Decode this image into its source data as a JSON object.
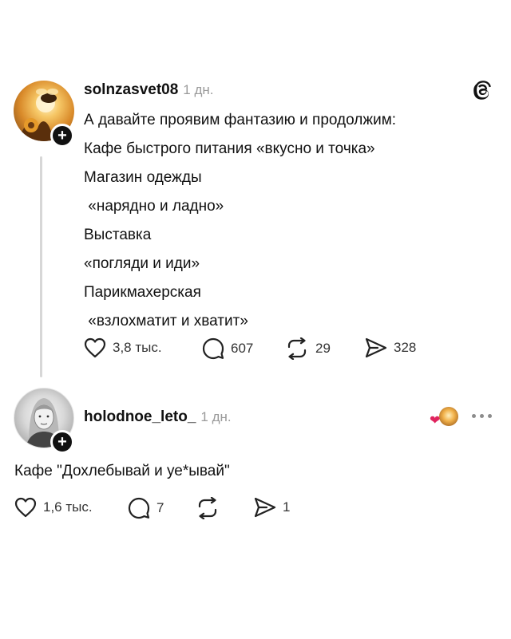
{
  "post": {
    "username": "solnzasvet08",
    "time": "1 дн.",
    "lines": [
      "А давайте проявим фантазию и продолжим:",
      "Кафе быстрого питания «вкусно и точка»",
      "Магазин одежды",
      " «нарядно и ладно»",
      "Выставка",
      "«погляди и иди»",
      "Парикмахерская",
      " «взлохматит и хватит»"
    ],
    "likes": "3,8 тыс.",
    "comments": "607",
    "reposts": "29",
    "shares": "328"
  },
  "reply": {
    "username": "holodnoe_leto_",
    "time": "1 дн.",
    "text": "Кафе \"Дохлебывай и уе*ывай\"",
    "likes": "1,6 тыс.",
    "comments": "7",
    "shares": "1"
  },
  "icons": {
    "threads_logo": "threads-logo-icon",
    "heart": "heart-icon",
    "comment": "comment-bubble-icon",
    "repost": "repost-icon",
    "share": "send-icon",
    "more": "more-dots-icon",
    "follow": "plus-icon"
  },
  "colors": {
    "text": "#111111",
    "muted": "#9a9a9a",
    "thread_line": "#d7d7d7",
    "heart_badge": "#e0245e"
  }
}
